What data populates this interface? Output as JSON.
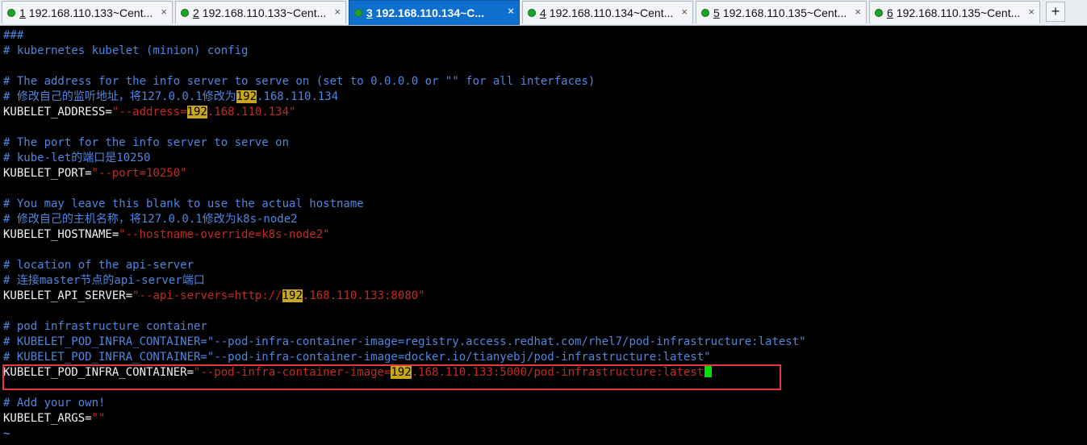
{
  "tabs": [
    {
      "num": "1",
      "label": "192.168.110.133~Cent...",
      "active": false
    },
    {
      "num": "2",
      "label": "192.168.110.133~Cent...",
      "active": false
    },
    {
      "num": "3",
      "label": "192.168.110.134~C...",
      "active": true
    },
    {
      "num": "4",
      "label": "192.168.110.134~Cent...",
      "active": false
    },
    {
      "num": "5",
      "label": "192.168.110.135~Cent...",
      "active": false
    },
    {
      "num": "6",
      "label": "192.168.110.135~Cent...",
      "active": false
    }
  ],
  "close_glyph": "×",
  "new_tab_glyph": "+",
  "editor": {
    "l1": "###",
    "l2": "# kubernetes kubelet (minion) config",
    "l3": "# The address for the info server to serve on (set to 0.0.0.0 or \"\" for all interfaces)",
    "l4a": "# 修改自己的监听地址，将127.0.0.1修改为",
    "l4hl": "192",
    "l4b": ".168.110.134",
    "l5key": "KUBELET_ADDRESS=",
    "l5a": "\"--address=",
    "l5hl": "192",
    "l5b": ".168.110.134\"",
    "l6": "# The port for the info server to serve on",
    "l7": "# kube-let的端口是10250",
    "l8key": "KUBELET_PORT=",
    "l8val": "\"--port=10250\"",
    "l9": "# You may leave this blank to use the actual hostname",
    "l10": "# 修改自己的主机名称，将127.0.0.1修改为k8s-node2",
    "l11key": "KUBELET_HOSTNAME=",
    "l11val": "\"--hostname-override=k8s-node2\"",
    "l12": "# location of the api-server",
    "l13": "# 连接master节点的api-server端口",
    "l14key": "KUBELET_API_SERVER=",
    "l14a": "\"--api-servers=http://",
    "l14hl": "192",
    "l14b": ".168.110.133:8080\"",
    "l15": "# pod infrastructure container",
    "l16": "# KUBELET_POD_INFRA_CONTAINER=\"--pod-infra-container-image=registry.access.redhat.com/rhel7/pod-infrastructure:latest\"",
    "l17": "# KUBELET_POD_INFRA_CONTAINER=\"--pod-infra-container-image=docker.io/tianyebj/pod-infrastructure:latest\"",
    "l18key": "KUBELET_POD_INFRA_CONTAINER=",
    "l18a": "\"--pod-infra-container-image=",
    "l18hl": "192",
    "l18b": ".168.110.133:5000/pod-infrastructure:latest",
    "l19": "# Add your own!",
    "l20key": "KUBELET_ARGS=",
    "l20val": "\"\"",
    "l21": "~"
  },
  "colors": {
    "comment": "#4f86e0",
    "string": "#c22b22",
    "highlight": "#c8a61d",
    "cursor": "#00e000",
    "annotation_box": "#e0393e",
    "active_tab": "#0f6fcf"
  }
}
